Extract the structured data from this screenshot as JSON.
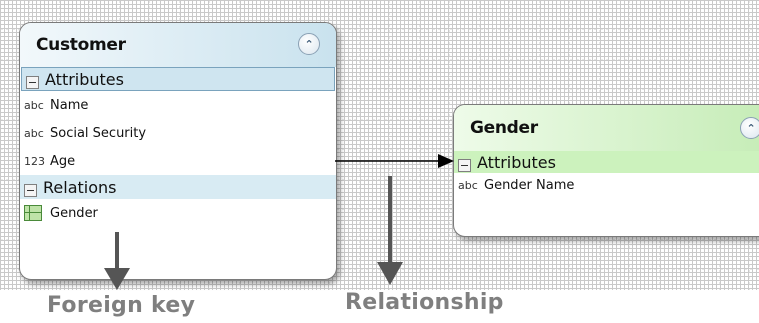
{
  "customer": {
    "title": "Customer",
    "attributes_label": "Attributes",
    "attributes": [
      {
        "type": "abc",
        "name": "Name"
      },
      {
        "type": "abc",
        "name": "Social Security"
      },
      {
        "type": "123",
        "name": "Age"
      }
    ],
    "relations_label": "Relations",
    "relations": [
      {
        "name": "Gender"
      }
    ]
  },
  "gender": {
    "title": "Gender",
    "attributes_label": "Attributes",
    "attributes": [
      {
        "type": "abc",
        "name": "Gender Name"
      }
    ]
  },
  "annotations": {
    "foreign_key": "Foreign key",
    "relationship": "Relationship"
  },
  "colors": {
    "customer_header": "#c9e2ee",
    "gender_header": "#c5ecb6",
    "annotation_text": "#7f7f7f",
    "annotation_arrow": "#555555"
  },
  "icons": {
    "collapse": "double-chevron-up-icon",
    "section_toggle": "minus-box-icon",
    "relation": "table-relation-icon"
  }
}
